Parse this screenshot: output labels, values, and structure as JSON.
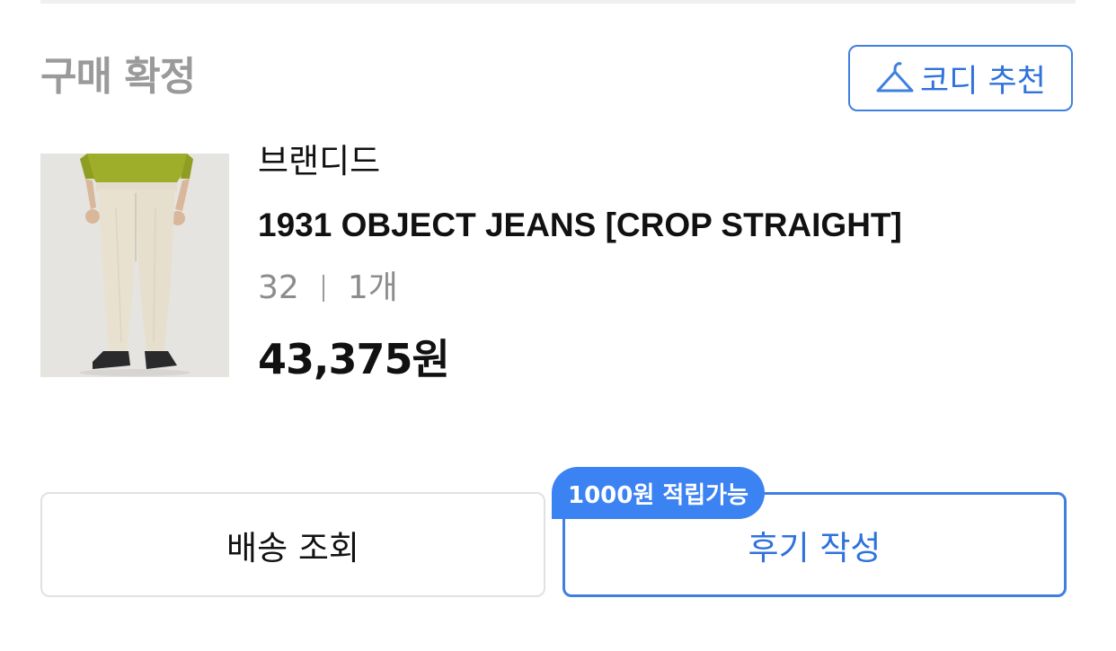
{
  "order": {
    "status": "구매 확정",
    "coordi_button": {
      "label": "코디 추천",
      "icon": "hanger-icon"
    }
  },
  "product": {
    "brand": "브랜디드",
    "name": "1931 OBJECT JEANS [CROP STRAIGHT]",
    "size": "32",
    "quantity": "1개",
    "price": "43,375원"
  },
  "actions": {
    "delivery_label": "배송 조회",
    "review_label": "후기 작성",
    "review_badge": "1000원 적립가능"
  },
  "colors": {
    "accent": "#3b82f2",
    "status_text": "#9a9a9a"
  }
}
